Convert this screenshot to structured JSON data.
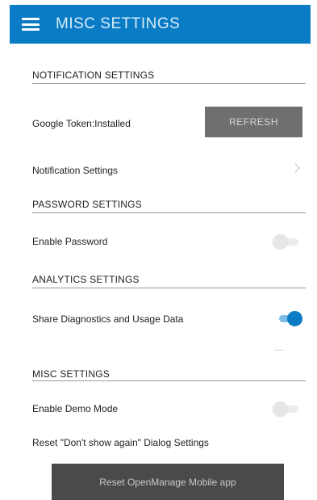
{
  "appbar": {
    "title": "MISC SETTINGS",
    "background": "#0a7bc5"
  },
  "notification": {
    "header": "NOTIFICATION SETTINGS",
    "google_token_label": "Google Token:Installed",
    "refresh_label": "REFRESH",
    "notification_settings_label": "Notification Settings"
  },
  "password": {
    "header": "PASSWORD SETTINGS",
    "enable_password_label": "Enable Password",
    "enable_password_on": false
  },
  "analytics": {
    "header": "ANALYTICS SETTINGS",
    "share_label": "Share Diagnostics and Usage Data",
    "share_on": true
  },
  "misc": {
    "header": "MISC SETTINGS",
    "demo_mode_label": "Enable Demo Mode",
    "demo_mode_on": false,
    "reset_dialog_label": "Reset \"Don't show again\" Dialog Settings",
    "reset_app_label": "Reset OpenManage Mobile app"
  },
  "icons": {
    "menu": "hamburger-menu-icon",
    "chevron": "chevron-right-icon"
  },
  "colors": {
    "accent": "#0a7bc5",
    "button_dark": "#4a4a4a",
    "button_gray": "#6f6f6f"
  }
}
